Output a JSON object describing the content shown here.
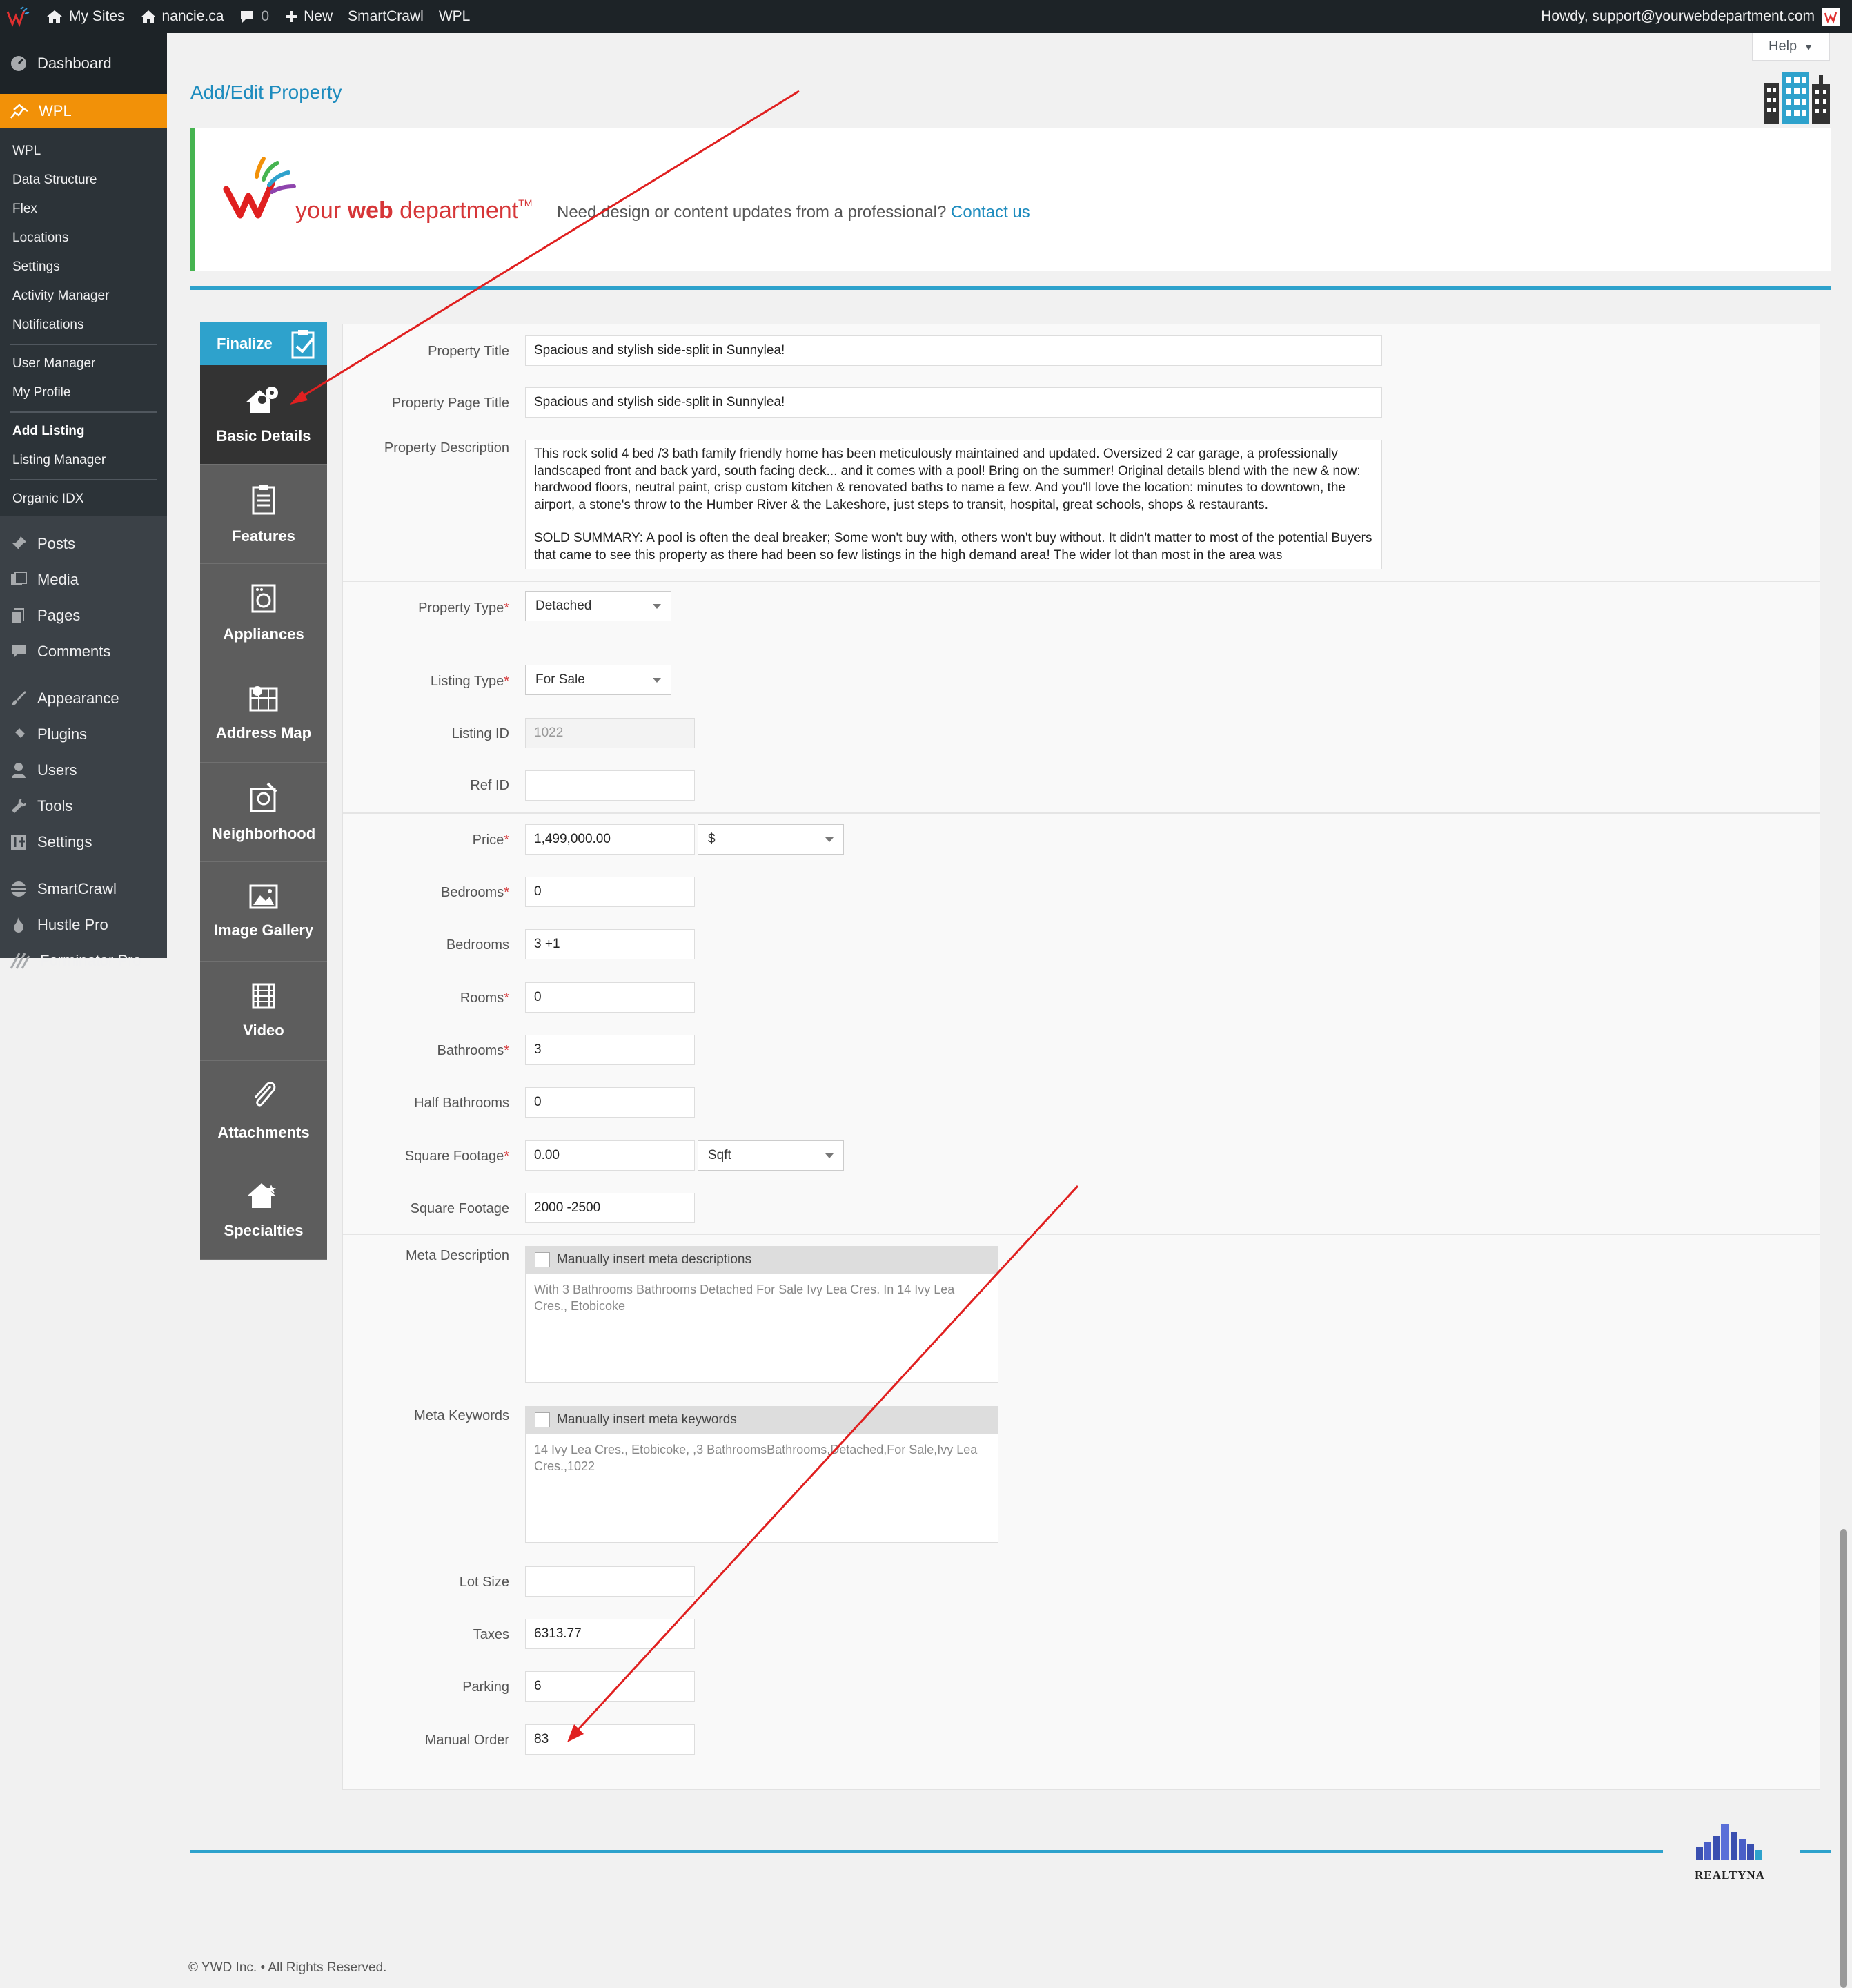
{
  "adminbar": {
    "my_sites": "My Sites",
    "site_name": "nancie.ca",
    "comments_count": "0",
    "new_label": "New",
    "smartcrawl": "SmartCrawl",
    "wpl": "WPL",
    "howdy": "Howdy, support@yourwebdepartment.com"
  },
  "sidebar": {
    "dashboard": "Dashboard",
    "wpl_top": "WPL",
    "sub1": [
      "WPL",
      "Data Structure",
      "Flex",
      "Locations",
      "Settings",
      "Activity Manager",
      "Notifications"
    ],
    "sub2": [
      "User Manager",
      "My Profile"
    ],
    "sub3": [
      "Add Listing",
      "Listing Manager"
    ],
    "sub4": [
      "Organic IDX"
    ],
    "lower": [
      "Posts",
      "Media",
      "Pages",
      "Comments",
      "Appearance",
      "Plugins",
      "Users",
      "Tools",
      "Settings",
      "SmartCrawl",
      "Hustle Pro",
      "Forminator Pro"
    ]
  },
  "help_label": "Help",
  "page_title": "Add/Edit Property",
  "banner": {
    "brand_your": "your ",
    "brand_web": "web",
    "brand_department": " department",
    "brand_tm": "TM",
    "text": "Need design or content updates from a professional? ",
    "link": "Contact us"
  },
  "tabs": {
    "finalize": "Finalize",
    "items": [
      "Basic Details",
      "Features",
      "Appliances",
      "Address Map",
      "Neighborhood",
      "Image Gallery",
      "Video",
      "Attachments",
      "Specialties"
    ]
  },
  "form": {
    "property_title_label": "Property Title",
    "property_title": "Spacious and stylish side-split in Sunnylea!",
    "page_title_label": "Property Page Title",
    "page_title": "Spacious and stylish side-split in Sunnylea!",
    "description_label": "Property Description",
    "description_p1": "This rock solid 4 bed /3 bath family friendly home has been meticulously maintained and updated. Oversized 2 car garage, a professionally landscaped front and back yard, south facing deck... and it comes with a pool! Bring on the summer! Original details blend with the new & now: hardwood floors, neutral paint, crisp custom kitchen & renovated baths to name a few. And you'll love the location: minutes to downtown, the airport, a stone's throw to the Humber River & the Lakeshore, just steps to transit, hospital, great schools, shops & restaurants.",
    "description_p2": "SOLD SUMMARY: A pool is often the deal breaker; Some won't buy with, others won't buy without. It didn't matter to most of the potential Buyers that came to see this property as there had been so few listings in the high demand area!  The wider lot than most in the area was",
    "property_type_label": "Property Type",
    "property_type": "Detached",
    "listing_type_label": "Listing Type",
    "listing_type": "For Sale",
    "listing_id_label": "Listing ID",
    "listing_id": "1022",
    "ref_id_label": "Ref ID",
    "ref_id": "",
    "price_label": "Price",
    "price": "1,499,000.00",
    "currency": "$",
    "bedrooms_req_label": "Bedrooms",
    "bedrooms_req": "0",
    "bedrooms_label": "Bedrooms",
    "bedrooms": "3 +1",
    "rooms_label": "Rooms",
    "rooms": "0",
    "bathrooms_label": "Bathrooms",
    "bathrooms": "3",
    "half_bathrooms_label": "Half Bathrooms",
    "half_bathrooms": "0",
    "sqft_req_label": "Square Footage",
    "sqft_req": "0.00",
    "sqft_unit": "Sqft",
    "sqft_label": "Square Footage",
    "sqft": "2000 -2500",
    "meta_desc_label": "Meta Description",
    "meta_desc_check": "Manually insert meta descriptions",
    "meta_desc": "With 3 Bathrooms Bathrooms Detached For Sale Ivy Lea Cres. In 14 Ivy Lea Cres., Etobicoke",
    "meta_kw_label": "Meta Keywords",
    "meta_kw_check": "Manually insert meta keywords",
    "meta_kw": "14 Ivy Lea Cres., Etobicoke, ,3 BathroomsBathrooms,Detached,For Sale,Ivy Lea Cres.,1022",
    "lot_size_label": "Lot Size",
    "lot_size": "",
    "taxes_label": "Taxes",
    "taxes": "6313.77",
    "parking_label": "Parking",
    "parking": "6",
    "manual_order_label": "Manual Order",
    "manual_order": "83"
  },
  "realtyna": "REALTYNA",
  "copyright": "© YWD Inc. • All Rights Reserved.",
  "colors": {
    "accent": "#2ea2cc",
    "wpl_orange": "#f29108",
    "sidebar": "#23282d",
    "annotation": "#e02020"
  }
}
